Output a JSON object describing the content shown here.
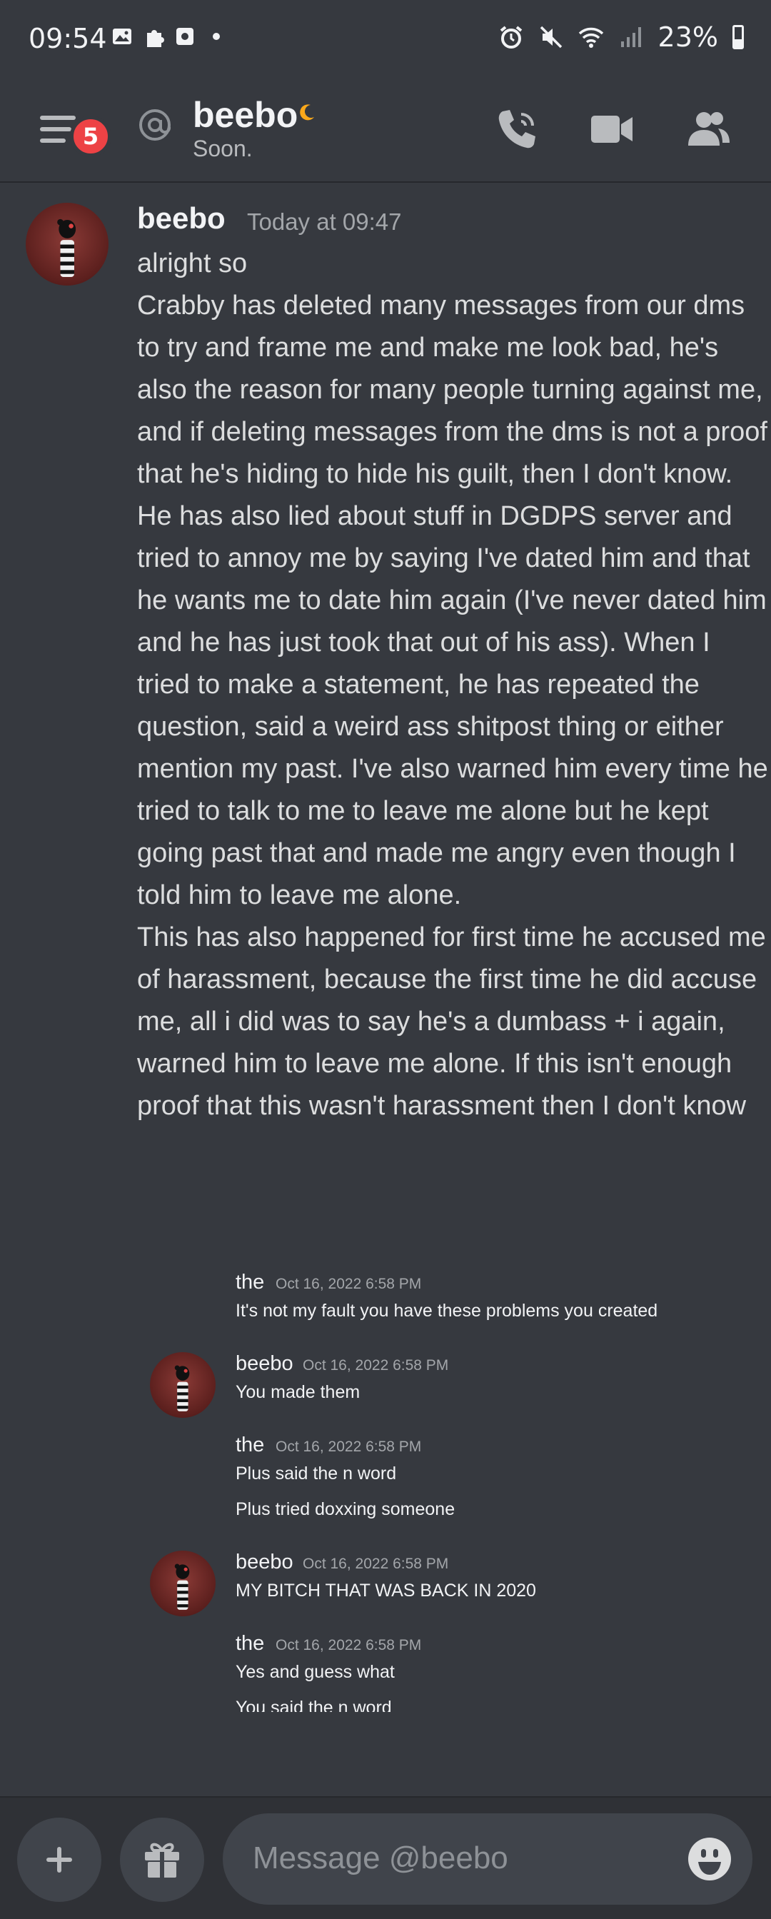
{
  "status_bar": {
    "time": "09:54",
    "battery": "23%"
  },
  "header": {
    "notification_count": "5",
    "username": "beebo",
    "status": "Soon."
  },
  "main_message": {
    "author": "beebo",
    "timestamp": "Today at 09:47",
    "paragraphs": [
      "alright so",
      "Crabby has deleted many messages from our dms to try and frame me and make me look bad, he's also the reason for many people turning against me, and if deleting messages from the dms is not a proof that he's hiding to hide his guilt, then I don't know. He has also lied about stuff in DGDPS server and tried to annoy me by saying I've dated him and that he wants me to date him again (I've never dated him and he has just took that out of his ass). When I tried to make a statement, he has repeated the question, said a weird ass shitpost thing or either mention my past. I've also warned him every time he tried to talk to me to leave me alone but he kept going past that and made me angry even though I told him to leave me alone.",
      "This has also happened for first time he accused me of harassment, because the first time he did accuse me, all i did was to say he's a dumbass + i again, warned him to leave me alone. If this isn't enough proof that this wasn't harassment then I don't know"
    ]
  },
  "screenshot_messages": [
    {
      "author": "the",
      "timestamp": "Oct 16, 2022 6:58 PM",
      "lines": [
        "It's not my fault you have these problems you created"
      ],
      "avatar": false
    },
    {
      "author": "beebo",
      "timestamp": "Oct 16, 2022 6:58 PM",
      "lines": [
        "You made them"
      ],
      "avatar": true
    },
    {
      "author": "the",
      "timestamp": "Oct 16, 2022 6:58 PM",
      "lines": [
        "Plus said the n word",
        "Plus tried doxxing someone"
      ],
      "avatar": false
    },
    {
      "author": "beebo",
      "timestamp": "Oct 16, 2022 6:58 PM",
      "lines": [
        "MY BITCH THAT WAS BACK IN 2020"
      ],
      "avatar": true
    },
    {
      "author": "the",
      "timestamp": "Oct 16, 2022 6:58 PM",
      "lines": [
        "Yes and guess what",
        "You said the n word"
      ],
      "avatar": false
    }
  ],
  "composer": {
    "placeholder": "Message @beebo"
  },
  "colors": {
    "background": "#36393f",
    "header_bg": "#36393f",
    "composer_bg": "#2f3136",
    "badge": "#ed4245",
    "idle_moon": "#faa81a"
  }
}
